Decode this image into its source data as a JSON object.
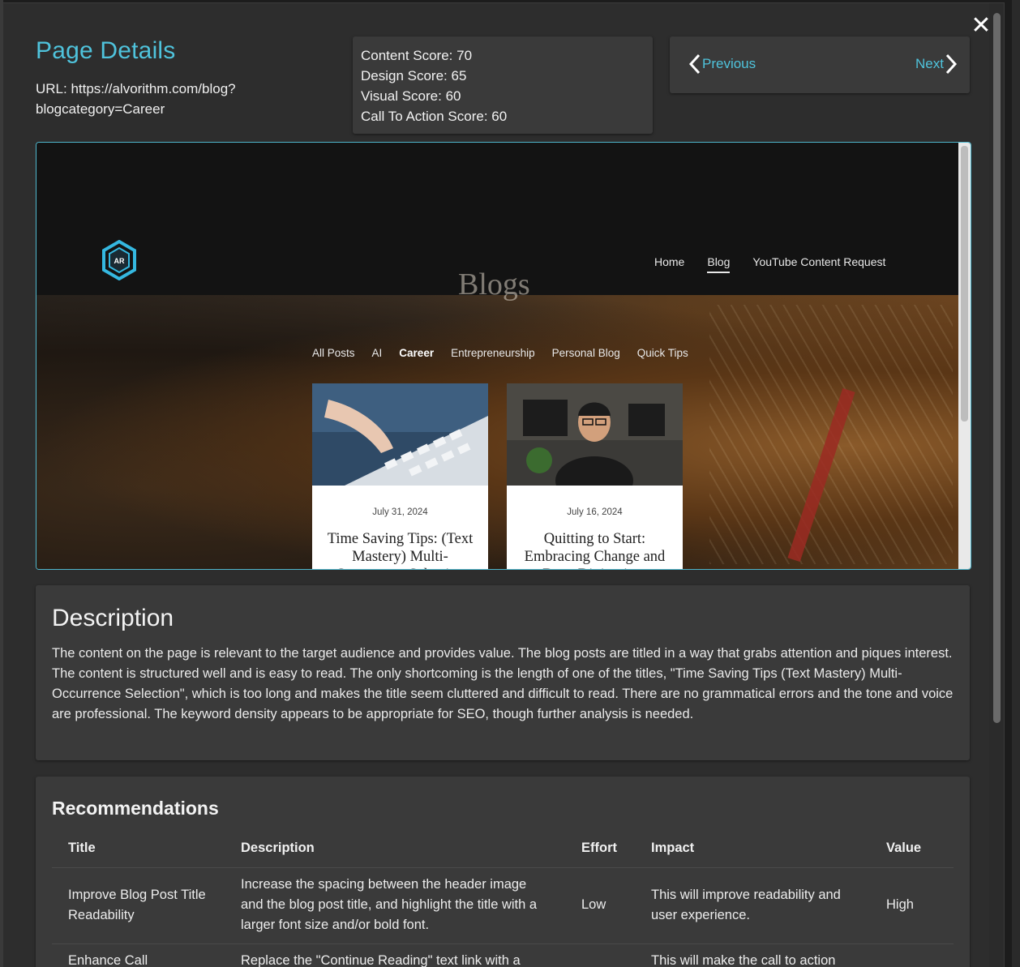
{
  "header": {
    "title": "Page Details",
    "url_line": "URL: https://alvorithm.com/blog?blogcategory=Career",
    "close_glyph": "✕"
  },
  "scores": [
    "Content Score: 70",
    "Design Score: 65",
    "Visual Score: 60",
    "Call To Action Score: 60"
  ],
  "pager": {
    "previous": "Previous",
    "next": "Next"
  },
  "preview": {
    "logo_text": "AR",
    "nav": [
      "Home",
      "Blog",
      "YouTube Content Request"
    ],
    "hero_title": "Blogs",
    "categories": [
      "All Posts",
      "AI",
      "Career",
      "Entrepreneurship",
      "Personal Blog",
      "Quick Tips"
    ],
    "cards": [
      {
        "date": "July 31, 2024",
        "title": "Time Saving Tips: (Text Mastery) Multi-Occurrence Selection"
      },
      {
        "date": "July 16, 2024",
        "title": "Quitting to Start: Embracing Change and Deep Diving into"
      }
    ]
  },
  "description": {
    "heading": "Description",
    "body": "The content on the page is relevant to the target audience and provides value. The blog posts are titled in a way that grabs attention and piques interest. The content is structured well and is easy to read. The only shortcoming is the length of one of the titles, \"Time Saving Tips (Text Mastery) Multi-Occurrence Selection\", which is too long and makes the title seem cluttered and difficult to read. There are no grammatical errors and the tone and voice are professional. The keyword density appears to be appropriate for SEO, though further analysis is needed."
  },
  "recommendations": {
    "heading": "Recommendations",
    "columns": [
      "Title",
      "Description",
      "Effort",
      "Impact",
      "Value"
    ],
    "rows": [
      {
        "title": "Improve Blog Post Title Readability",
        "description": "Increase the spacing between the header image and the blog post title, and highlight the title with a larger font size and/or bold font.",
        "effort": "Low",
        "impact": "This will improve readability and user experience.",
        "value": "High"
      },
      {
        "title": "Enhance Call",
        "description": "Replace the \"Continue Reading\" text link with a",
        "effort": "",
        "impact": "This will make the call to action",
        "value": ""
      }
    ]
  },
  "colors": {
    "accent": "#4fc3dc",
    "panel": "#3a3a3a",
    "modal": "#2d2d2d"
  }
}
